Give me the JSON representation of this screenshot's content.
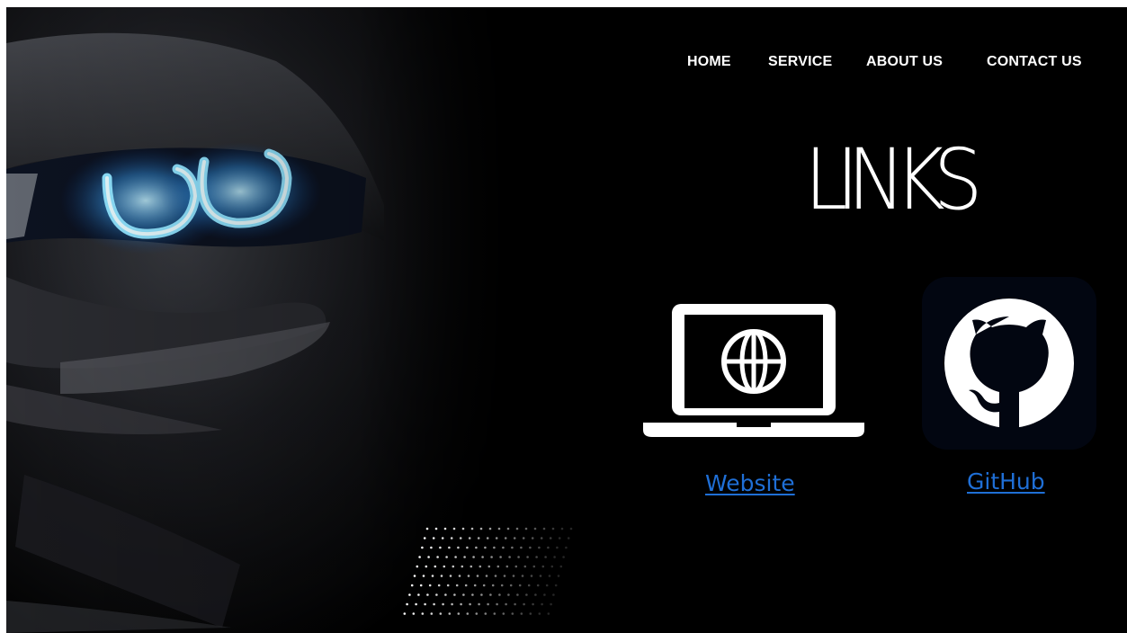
{
  "nav": {
    "home": "HOME",
    "service": "SERVICE",
    "about": "ABOUT US",
    "contact": "CONTACT US"
  },
  "title": "LINKS",
  "links": [
    {
      "label": "Website",
      "icon": "laptop-globe-icon"
    },
    {
      "label": "GitHub",
      "icon": "github-icon"
    }
  ],
  "hero": {
    "icon": "car-headlight-image"
  },
  "colors": {
    "background": "#000000",
    "text": "#ffffff",
    "link": "#1f6fd6",
    "headlight_glow": "#6fd0ff"
  }
}
